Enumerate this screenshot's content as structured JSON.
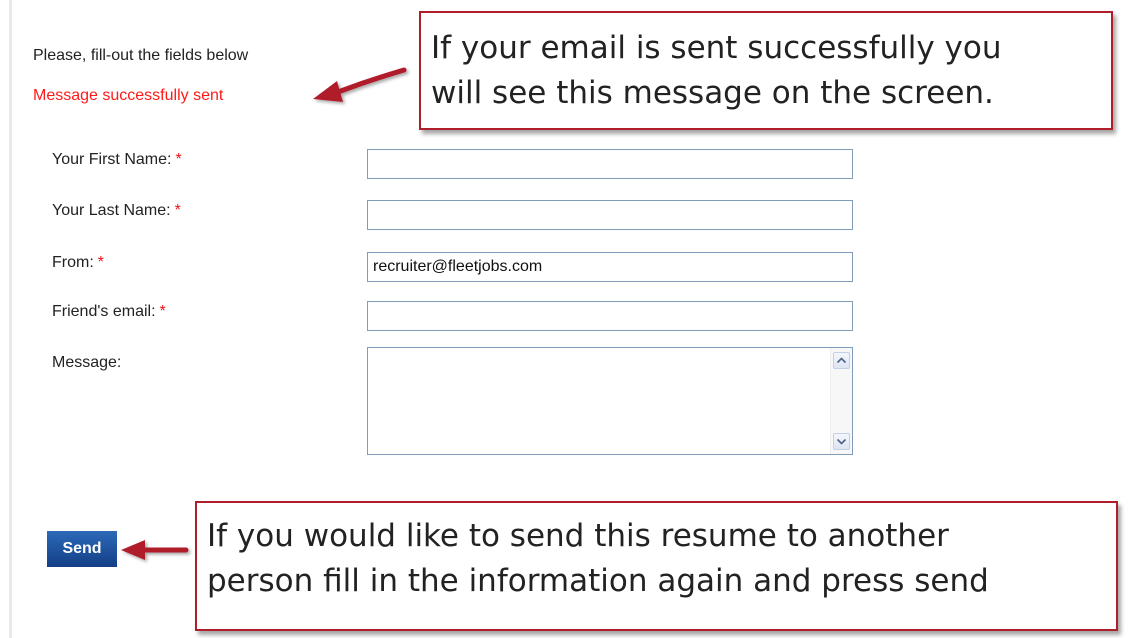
{
  "form": {
    "intro_text": "Please, fill-out the fields below",
    "status_message": "Message successfully sent",
    "required_marker": "*",
    "fields": {
      "first_name": {
        "label": "Your First Name:",
        "value": ""
      },
      "last_name": {
        "label": "Your Last Name:",
        "value": ""
      },
      "from": {
        "label": "From:",
        "value": "recruiter@fleetjobs.com"
      },
      "friend_email": {
        "label": "Friend's email:",
        "value": ""
      },
      "message": {
        "label": "Message:",
        "value": ""
      }
    },
    "send_label": "Send"
  },
  "annotations": {
    "top": {
      "line1": "If your email is sent successfully you",
      "line2": "will see this message on the screen."
    },
    "bottom": {
      "line1": "If you would like to send this resume to another",
      "line2": "person fill in the information again and press send"
    }
  },
  "colors": {
    "status_message": "#ff1a1a",
    "required_marker": "#ee1111",
    "send_button": "#1c4f9c",
    "callout_border": "#b01e2a",
    "arrow": "#b01e2a"
  },
  "icons": {
    "scroll_up": "scroll-up-arrow",
    "scroll_down": "scroll-down-arrow",
    "pointer_arrow": "red-pointer-arrow"
  }
}
